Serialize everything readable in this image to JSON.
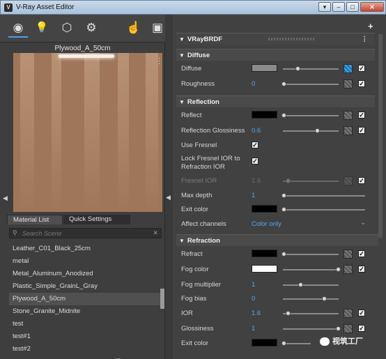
{
  "window": {
    "title": "V-Ray Asset Editor",
    "controls": [
      "▾",
      "–",
      "□",
      "✕"
    ]
  },
  "left": {
    "top_tabs": [
      {
        "icon": "materials-icon",
        "glyph": "◉",
        "active": true
      },
      {
        "icon": "lights-icon",
        "glyph": "💡",
        "active": false
      },
      {
        "icon": "geometry-icon",
        "glyph": "⬡",
        "active": false
      },
      {
        "icon": "settings-icon",
        "glyph": "⚙",
        "active": false
      },
      {
        "icon": "render-interactive-icon",
        "glyph": "☝",
        "active": false
      },
      {
        "icon": "render-output-icon",
        "glyph": "▣",
        "active": false
      }
    ],
    "preview_title": "Plywood_A_50cm",
    "material_tabs": [
      "Material List",
      "Quick Settings"
    ],
    "search_placeholder": "Search Scene",
    "materials": [
      "Leather_C01_Black_25cm",
      "metal",
      "Metal_Aluminum_Anodized",
      "Plastic_Simple_GrainL_Gray",
      "Plywood_A_50cm",
      "Stone_Granite_Midnite",
      "test",
      "test#1",
      "test#2"
    ],
    "selected_material": "Plywood_A_50cm",
    "bottom_icons": [
      "new-material-icon",
      "open-folder-icon",
      "save-icon",
      "delete-icon",
      "import-icon"
    ]
  },
  "right": {
    "plus": "+",
    "header": "VRayBRDF",
    "sections": {
      "diffuse": "Diffuse",
      "reflection": "Reflection",
      "refraction": "Refraction"
    },
    "params": {
      "diffuse": {
        "label": "Diffuse",
        "color": "#8a8a8a",
        "level": 0.33
      },
      "roughness": {
        "label": "Roughness",
        "value": "0"
      },
      "reflect": {
        "label": "Reflect",
        "color": "#000000"
      },
      "refl_gloss": {
        "label": "Reflection Glossiness",
        "value": "0.6"
      },
      "use_fresnel": {
        "label": "Use Fresnel"
      },
      "lock_fresnel": {
        "label1": "Lock Fresnel IOR to",
        "label2": "Refraction IOR"
      },
      "fresnel_ior": {
        "label": "Fresnel IOR",
        "value": "1.6"
      },
      "max_depth": {
        "label": "Max depth",
        "value": "1"
      },
      "exit_color": {
        "label": "Exit color",
        "color": "#000000"
      },
      "affect_channels": {
        "label": "Affect channels",
        "value": "Color only"
      },
      "refract": {
        "label": "Refract",
        "color": "#000000"
      },
      "fog_color": {
        "label": "Fog color",
        "color": "#ffffff"
      },
      "fog_mult": {
        "label": "Fog multiplier",
        "value": "1"
      },
      "fog_bias": {
        "label": "Fog bias",
        "value": "0"
      },
      "ior": {
        "label": "IOR",
        "value": "1.6"
      },
      "glossiness": {
        "label": "Glossiness",
        "value": "1"
      },
      "exit_color2": {
        "label": "Exit color",
        "color": "#000000"
      }
    }
  },
  "watermark": "视筑工厂"
}
